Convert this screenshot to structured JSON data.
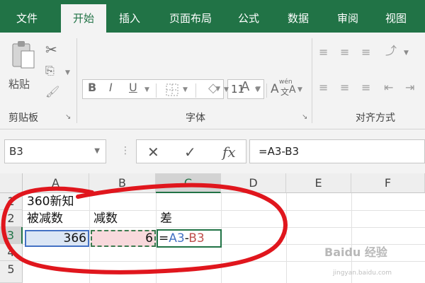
{
  "tabs": [
    "文件",
    "开始",
    "插入",
    "页面布局",
    "公式",
    "数据",
    "审阅",
    "视图"
  ],
  "active_tab_index": 1,
  "ribbon": {
    "clipboard": {
      "paste_label": "粘贴",
      "group_label": "剪贴板"
    },
    "font": {
      "font_name": "",
      "font_size": "11",
      "grow_font": "A",
      "shrink_font": "A",
      "bold": "B",
      "italic": "I",
      "underline": "U",
      "font_color": "A",
      "phonetic": "wén",
      "group_label": "字体"
    },
    "alignment": {
      "group_label": "对齐方式"
    }
  },
  "formula_bar": {
    "name_box": "B3",
    "cancel": "✕",
    "enter": "✓",
    "fx": "fx",
    "formula": "=A3-B3"
  },
  "grid": {
    "columns": [
      "A",
      "B",
      "C",
      "D",
      "E",
      "F"
    ],
    "rows": [
      "1",
      "2",
      "3",
      "4",
      "5"
    ],
    "cells": {
      "A1": "360新知",
      "A2": "被减数",
      "B2": "减数",
      "C2": "差",
      "A3": "366",
      "B3": "6",
      "C3_eq": "=",
      "C3_ref1": "A3",
      "C3_op": "-",
      "C3_ref2": "B3"
    }
  },
  "watermark": {
    "brand": "Baidu 经验",
    "url": "jingyan.baidu.com"
  },
  "colors": {
    "excel_green": "#217346",
    "ref_blue": "#4472c4",
    "ref_red": "#c0504d",
    "annotation_red": "#e0161d"
  }
}
